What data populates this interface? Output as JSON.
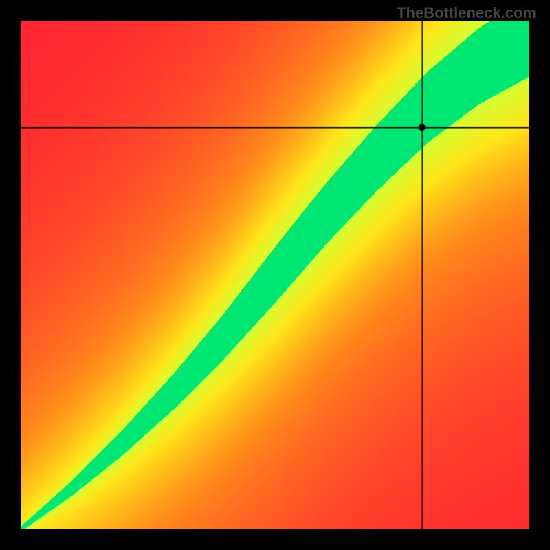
{
  "watermark": "TheBottleneck.com",
  "chart_data": {
    "type": "heatmap",
    "title": "",
    "xlabel": "",
    "ylabel": "",
    "xlim": [
      0,
      100
    ],
    "ylim": [
      0,
      100
    ],
    "description": "Bottleneck compatibility heatmap. Green diagonal band indicates balanced pairing; red regions indicate bottleneck. Crosshair marks a specific (x,y) combination near the upper-right of the diagonal.",
    "crosshair": {
      "x": 79,
      "y": 79
    },
    "band": {
      "note": "Green band follows a slightly super-linear curve from origin to top-right; width grows with x.",
      "samples_x": [
        0,
        10,
        20,
        30,
        40,
        50,
        60,
        70,
        80,
        90,
        100
      ],
      "center_y": [
        0,
        8,
        17,
        27,
        38,
        50,
        62,
        73,
        83,
        91,
        97
      ],
      "halfwidth_green": [
        0.5,
        1.5,
        2.5,
        3.5,
        4.5,
        5.5,
        6.0,
        6.5,
        7.0,
        7.5,
        8.0
      ],
      "halfwidth_yellow": [
        1.5,
        4,
        6,
        8,
        10,
        12,
        13,
        14,
        15,
        16,
        17
      ]
    },
    "colorscale": {
      "0.00": "#ff1a33",
      "0.45": "#ff8c1a",
      "0.70": "#ffe61a",
      "0.85": "#d4ff33",
      "1.00": "#00e673"
    }
  }
}
